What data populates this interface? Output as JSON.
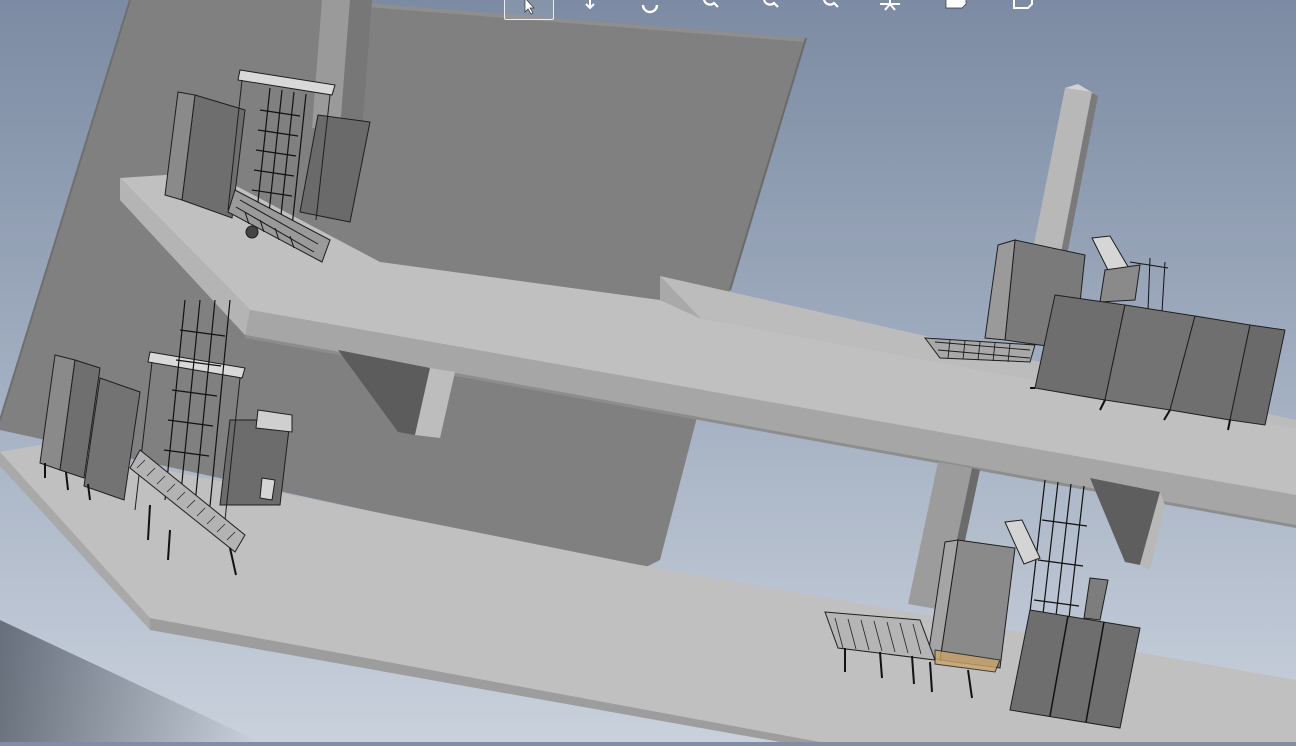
{
  "viewport": {
    "background_top": "#7f8ea6",
    "background_bottom": "#cdd4de",
    "wall_color": "#808080",
    "floor_color": "#c0c0c0",
    "floor_edge_color": "#9a9a9a",
    "machine_dark": "#4a4a4a"
  },
  "heads_up_toolbar": {
    "tools": [
      {
        "icon": "select-arrow-icon",
        "selected": true
      },
      {
        "icon": "rotate-view-icon",
        "selected": false
      },
      {
        "icon": "rotate-orbit-icon",
        "selected": false
      },
      {
        "icon": "zoom-to-fit-icon",
        "selected": false
      },
      {
        "icon": "zoom-to-area-icon",
        "selected": false
      },
      {
        "icon": "zoom-in-out-icon",
        "selected": false
      },
      {
        "icon": "view-orientation-icon",
        "selected": false
      },
      {
        "icon": "display-style-icon",
        "selected": false
      },
      {
        "icon": "hide-show-items-icon",
        "selected": false
      }
    ]
  }
}
